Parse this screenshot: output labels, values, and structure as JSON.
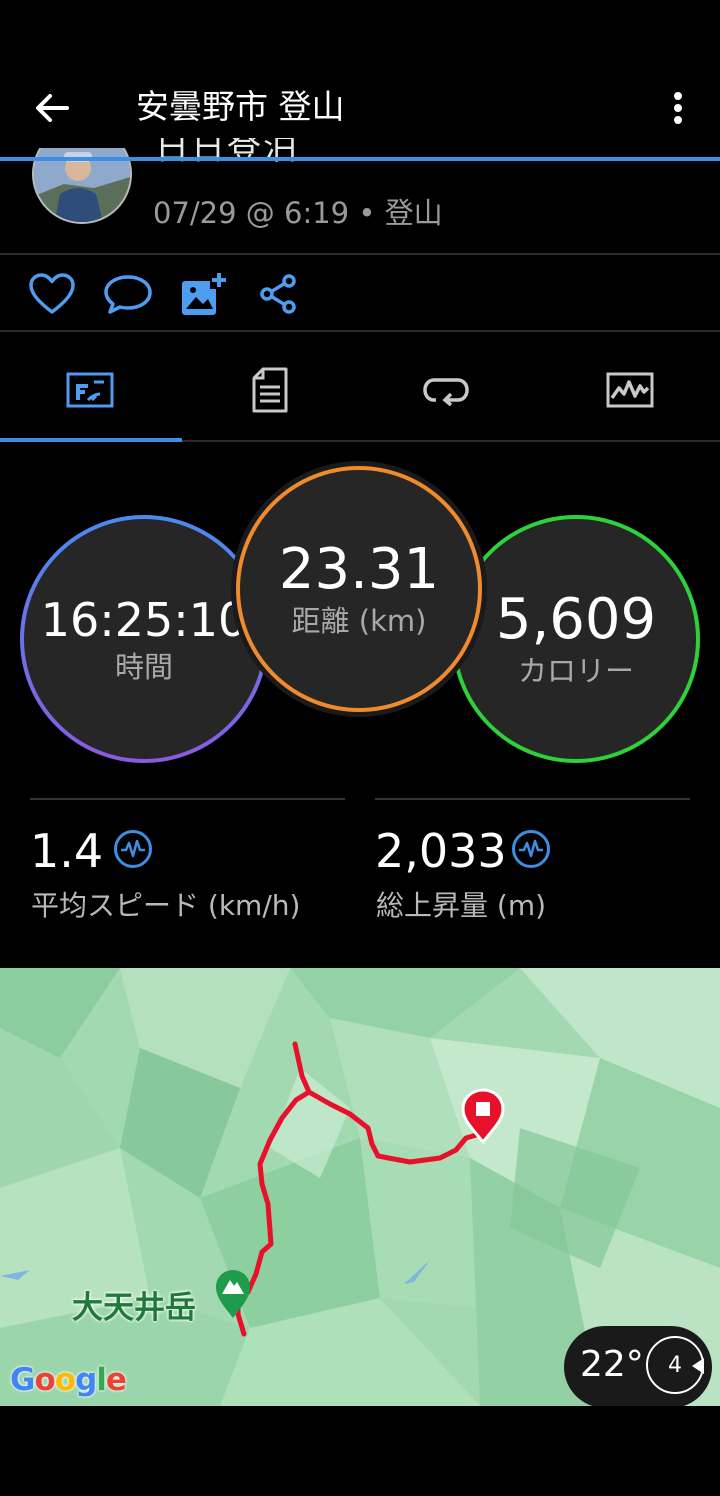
{
  "header": {
    "title": "安曇野市 登山"
  },
  "activity": {
    "meta": "07/29 @ 6:19 • 登山",
    "name_partial": "日日登泊"
  },
  "tabs": [
    {
      "icon": "summary-icon"
    },
    {
      "icon": "details-icon"
    },
    {
      "icon": "laps-icon"
    },
    {
      "icon": "charts-icon"
    }
  ],
  "metrics": {
    "time": {
      "value": "16:25:10",
      "label": "時間"
    },
    "distance": {
      "value": "23.31",
      "label": "距離 (km)"
    },
    "calories": {
      "value": "5,609",
      "label": "カロリー"
    }
  },
  "stats": {
    "avg_speed": {
      "value": "1.4",
      "label": "平均スピード (km/h)"
    },
    "ascent": {
      "value": "2,033",
      "label": "総上昇量 (m)"
    }
  },
  "map": {
    "peak_label": "大天井岳",
    "google": "Google",
    "temperature": "22°",
    "wind": "4"
  },
  "colors": {
    "accent": "#3d8fe3",
    "distance_ring": "#f08a2e",
    "calorie_ring": "#2ed13a",
    "route": "#e8102a"
  }
}
